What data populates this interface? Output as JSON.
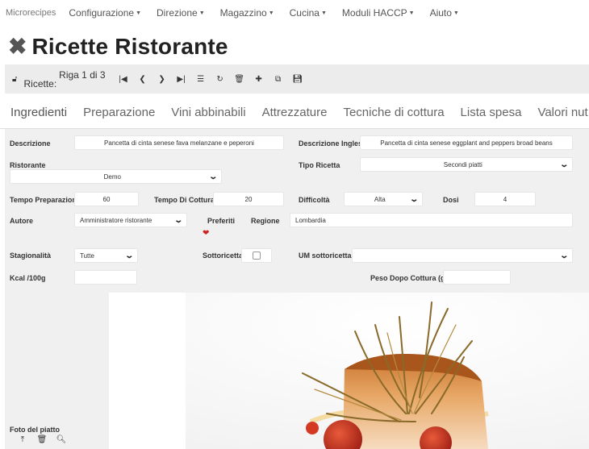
{
  "navbar": {
    "brand": "Microrecipes",
    "items": [
      {
        "label": "Configurazione"
      },
      {
        "label": "Direzione"
      },
      {
        "label": "Magazzino"
      },
      {
        "label": "Cucina"
      },
      {
        "label": "Moduli HACCP"
      },
      {
        "label": "Aiuto"
      }
    ]
  },
  "page": {
    "title": "Ricette Ristorante"
  },
  "toolbar": {
    "record_name": "Ricette:",
    "record_position": "Riga 1 di 3"
  },
  "tabs": [
    {
      "label": "Ingredienti"
    },
    {
      "label": "Preparazione"
    },
    {
      "label": "Vini abbinabili"
    },
    {
      "label": "Attrezzature"
    },
    {
      "label": "Tecniche di cottura"
    },
    {
      "label": "Lista spesa"
    },
    {
      "label": "Valori nut"
    }
  ],
  "form": {
    "descrizione": {
      "label": "Descrizione",
      "value": "Pancetta di cinta senese fava melanzane e peperoni"
    },
    "descrizione_inglese": {
      "label": "Descrizione Inglese",
      "value": "Pancetta di cinta senese eggplant and peppers broad beans"
    },
    "ristorante": {
      "label": "Ristorante",
      "value": "Demo"
    },
    "tipo_ricetta": {
      "label": "Tipo Ricetta",
      "value": "Secondi piatti"
    },
    "tempo_preparazione": {
      "label": "Tempo Preparazione",
      "value": "60"
    },
    "tempo_cottura": {
      "label": "Tempo Di Cottura",
      "value": "20"
    },
    "difficolta": {
      "label": "Difficoltà",
      "value": "Alta"
    },
    "dosi": {
      "label": "Dosi",
      "value": "4"
    },
    "autore": {
      "label": "Autore",
      "value": "Amministratore ristorante"
    },
    "preferiti": {
      "label": "Preferiti"
    },
    "regione": {
      "label": "Regione",
      "value": "Lombardia"
    },
    "stagionalita": {
      "label": "Stagionalità",
      "value": "Tutte"
    },
    "sottoricetta": {
      "label": "Sottoricetta",
      "checked": false
    },
    "um_sottoricetta": {
      "label": "UM sottoricetta",
      "value": ""
    },
    "kcal": {
      "label": "Kcal /100g",
      "value": ""
    },
    "peso_dopo_cottura": {
      "label": "Peso Dopo Cottura (gr.)",
      "value": ""
    },
    "foto": {
      "label": "Foto del piatto"
    }
  },
  "colors": {
    "form_background": "#f0f0f0",
    "toolbar_background": "#ececec",
    "heart": "#cc2222"
  }
}
